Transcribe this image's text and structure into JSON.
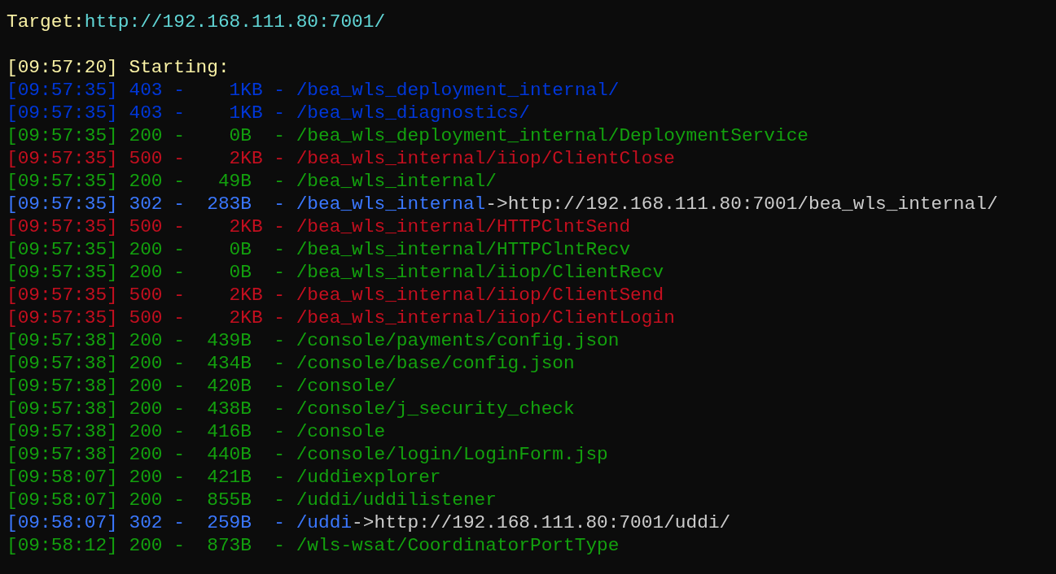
{
  "target": {
    "label": "Target:",
    "url": "http://192.168.111.80:7001/"
  },
  "starting": "[09:57:20] Starting:",
  "rows": [
    {
      "text": "[09:57:35] 403 -    1KB - /bea_wls_deployment_internal/",
      "color": "#0037da"
    },
    {
      "text": "[09:57:35] 403 -    1KB - /bea_wls_diagnostics/",
      "color": "#0037da"
    },
    {
      "text": "[09:57:35] 200 -    0B  - /bea_wls_deployment_internal/DeploymentService",
      "color": "#13a10e"
    },
    {
      "text": "[09:57:35] 500 -    2KB - /bea_wls_internal/iiop/ClientClose",
      "color": "#c50f1f"
    },
    {
      "text": "[09:57:35] 200 -   49B  - /bea_wls_internal/",
      "color": "#13a10e"
    },
    {
      "text": "[09:57:35] 302 -  283B  - /bea_wls_internal",
      "color": "#3b78ff",
      "arrow": "->",
      "redirect": "http://192.168.111.80:7001/bea_wls_internal/"
    },
    {
      "text": "[09:57:35] 500 -    2KB - /bea_wls_internal/HTTPClntSend",
      "color": "#c50f1f"
    },
    {
      "text": "[09:57:35] 200 -    0B  - /bea_wls_internal/HTTPClntRecv",
      "color": "#13a10e"
    },
    {
      "text": "[09:57:35] 200 -    0B  - /bea_wls_internal/iiop/ClientRecv",
      "color": "#13a10e"
    },
    {
      "text": "[09:57:35] 500 -    2KB - /bea_wls_internal/iiop/ClientSend",
      "color": "#c50f1f"
    },
    {
      "text": "[09:57:35] 500 -    2KB - /bea_wls_internal/iiop/ClientLogin",
      "color": "#c50f1f"
    },
    {
      "text": "[09:57:38] 200 -  439B  - /console/payments/config.json",
      "color": "#13a10e"
    },
    {
      "text": "[09:57:38] 200 -  434B  - /console/base/config.json",
      "color": "#13a10e"
    },
    {
      "text": "[09:57:38] 200 -  420B  - /console/",
      "color": "#13a10e"
    },
    {
      "text": "[09:57:38] 200 -  438B  - /console/j_security_check",
      "color": "#13a10e"
    },
    {
      "text": "[09:57:38] 200 -  416B  - /console",
      "color": "#13a10e"
    },
    {
      "text": "[09:57:38] 200 -  440B  - /console/login/LoginForm.jsp",
      "color": "#13a10e"
    },
    {
      "text": "[09:58:07] 200 -  421B  - /uddiexplorer",
      "color": "#13a10e"
    },
    {
      "text": "[09:58:07] 200 -  855B  - /uddi/uddilistener",
      "color": "#13a10e"
    },
    {
      "text": "[09:58:07] 302 -  259B  - /uddi",
      "color": "#3b78ff",
      "arrow": "->",
      "redirect": "http://192.168.111.80:7001/uddi/"
    },
    {
      "text": "[09:58:12] 200 -  873B  - /wls-wsat/CoordinatorPortType",
      "color": "#13a10e"
    }
  ]
}
